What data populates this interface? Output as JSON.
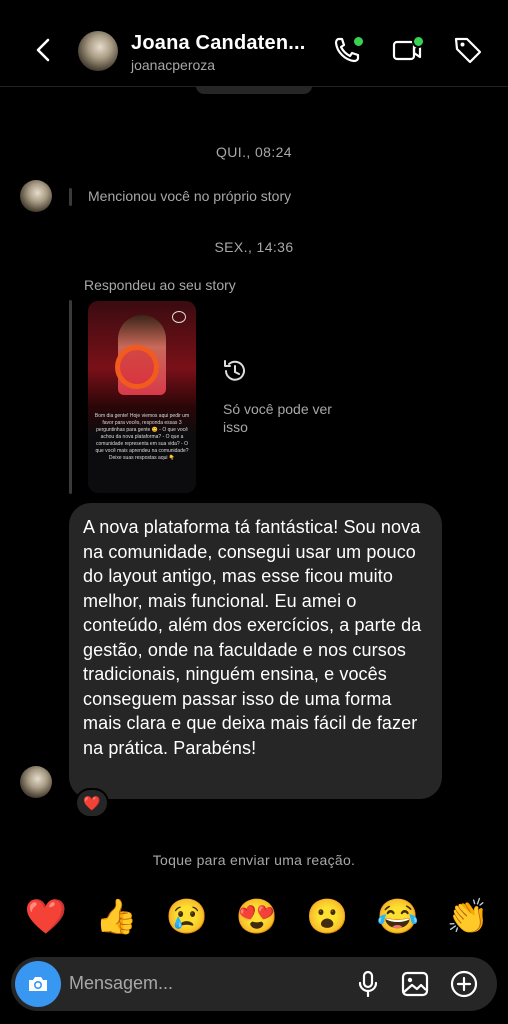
{
  "header": {
    "name": "Joana Candaten...",
    "username": "joanacperoza",
    "icons": [
      "back-arrow-icon",
      "phone-icon",
      "video-icon",
      "tag-icon"
    ],
    "online_color": "#39d353"
  },
  "thread": {
    "timestamp_1": "QUI., 08:24",
    "mention_note": "Mencionou você no próprio story",
    "timestamp_2": "SEX., 14:36",
    "reply_note": "Respondeu ao seu story",
    "story_text": "Bom dia gente! Hoje viemos aqui pedir um favor para vocês, responda essas 3 perguntinhas para gente 😊 - O que você achou da nova plataforma? - O que a comunidade representa em sua vida? - O que você mais aprendeu na comunidade? Deixe suas respostas aqui 👇",
    "privacy_text": "Só você pode ver isso",
    "message": "A nova plataforma tá fantástica! Sou nova na comunidade, consegui usar um pouco do layout antigo, mas esse ficou muito melhor, mais funcional. Eu amei o conteúdo, além dos exercícios, a parte da gestão, onde na faculdade e nos cursos tradicionais, ninguém ensina, e vocês conseguem passar isso de uma forma mais clara e que deixa mais fácil de fazer na prática. Parabéns!",
    "reaction": "❤️"
  },
  "reactions": {
    "hint": "Toque para enviar uma reação.",
    "emojis": [
      "❤️",
      "👍",
      "😢",
      "😍",
      "😮",
      "😂",
      "👏"
    ]
  },
  "composer": {
    "placeholder": "Mensagem...",
    "accent": "#3897f0",
    "icons": [
      "camera-icon",
      "microphone-icon",
      "gallery-icon",
      "plus-icon"
    ]
  }
}
